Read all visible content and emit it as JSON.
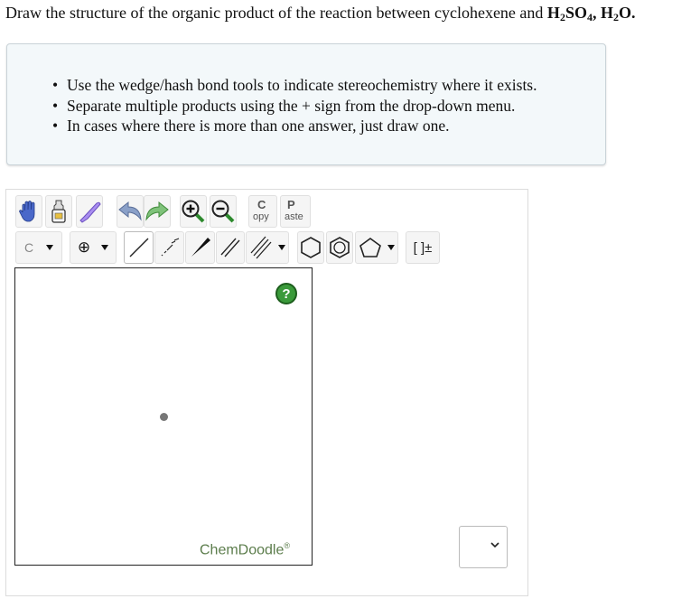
{
  "question": {
    "text": "Draw the structure of the organic product of the reaction between cyclohexene and",
    "reagent1_base": "H",
    "reagent1_sub1": "2",
    "reagent1_mid": "SO",
    "reagent1_sub2": "4",
    "separator": ",",
    "reagent2_base": "H",
    "reagent2_sub": "2",
    "reagent2_end": "O",
    "period": "."
  },
  "instructions": [
    "Use the wedge/hash bond tools to indicate stereochemistry where it exists.",
    "Separate multiple products using the + sign from the drop-down menu.",
    "In cases where there is more than one answer, just draw one."
  ],
  "toolbar": {
    "row1": [
      "hand-icon",
      "eraser-bottle-icon",
      "lasso-icon",
      "undo-icon",
      "redo-icon",
      "zoom-in-icon",
      "zoom-out-icon"
    ],
    "copy_top": "C",
    "copy_bottom": "opy",
    "paste_top": "P",
    "paste_bottom": "aste",
    "element_label": "C",
    "charge_label": "⊕",
    "bracket_label": "[ ]±"
  },
  "canvas": {
    "help_label": "?",
    "brand": "ChemDoodle",
    "brand_mark": "®"
  },
  "answer_select": {
    "value": ""
  },
  "colors": {
    "info_bg": "#f3f8fa",
    "help_green": "#3a9a3a",
    "brand_green": "#5c7d4c"
  }
}
